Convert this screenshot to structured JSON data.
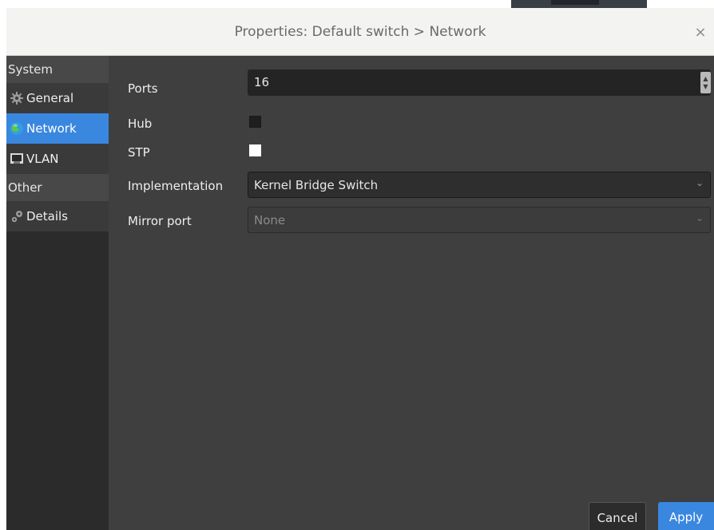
{
  "window": {
    "title": "Properties: Default switch > Network",
    "close_glyph": "×"
  },
  "sidebar": {
    "system_header": "System",
    "other_header": "Other",
    "items": [
      {
        "label": "General",
        "icon": "gear-icon",
        "selected": false
      },
      {
        "label": "Network",
        "icon": "globe-icon",
        "selected": true
      },
      {
        "label": "VLAN",
        "icon": "network-card-icon",
        "selected": false
      },
      {
        "label": "Details",
        "icon": "gears-icon",
        "selected": false
      }
    ]
  },
  "form": {
    "ports": {
      "label": "Ports",
      "value": "16"
    },
    "hub": {
      "label": "Hub",
      "checked": false
    },
    "stp": {
      "label": "STP",
      "checked": true
    },
    "implementation": {
      "label": "Implementation",
      "value": "Kernel Bridge Switch"
    },
    "mirror_port": {
      "label": "Mirror port",
      "value": "None",
      "disabled": true
    }
  },
  "buttons": {
    "cancel": "Cancel",
    "apply": "Apply"
  },
  "colors": {
    "accent": "#3a87e0",
    "panel": "#3f3f3f",
    "sidebar": "#2b2b2b"
  }
}
